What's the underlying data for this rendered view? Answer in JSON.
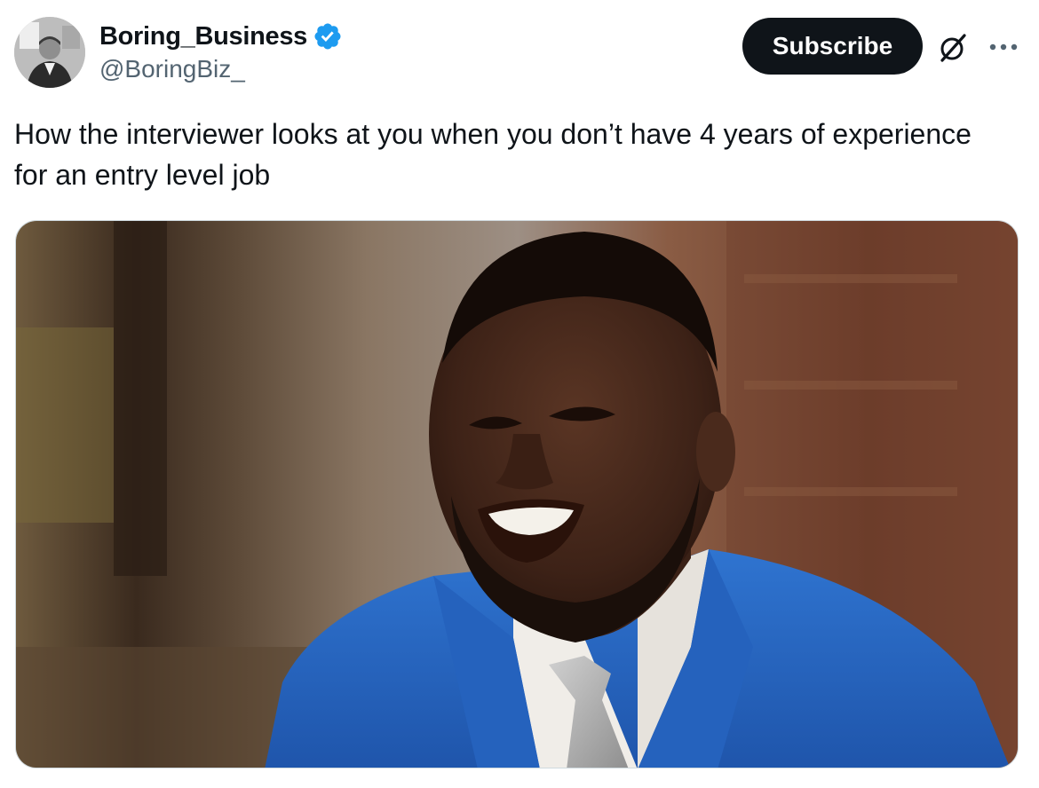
{
  "tweet": {
    "author": {
      "display_name": "Boring_Business",
      "handle": "@BoringBiz_",
      "verified": true,
      "avatar_icon": "avatar-portrait-icon"
    },
    "subscribe_label": "Subscribe",
    "text": "How the interviewer looks at you when you don’t have 4 years of experience for an entry level job",
    "media": {
      "type": "photo"
    },
    "icons": {
      "verified": "verified-badge-icon",
      "grok": "grok-icon",
      "more": "more-options-icon"
    },
    "colors": {
      "verified_blue": "#1d9bf0",
      "subscribe_bg": "#0f1419",
      "handle_gray": "#536471"
    }
  }
}
